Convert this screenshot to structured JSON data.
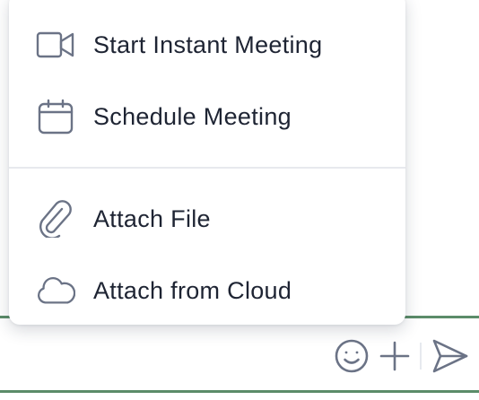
{
  "menu": {
    "items": [
      {
        "label": "Start Instant Meeting",
        "icon": "video-camera-icon"
      },
      {
        "label": "Schedule Meeting",
        "icon": "calendar-icon"
      },
      {
        "label": "Attach File",
        "icon": "paperclip-icon"
      },
      {
        "label": "Attach from Cloud",
        "icon": "cloud-icon"
      }
    ]
  },
  "composer": {
    "actions": [
      {
        "icon": "emoji-icon"
      },
      {
        "icon": "plus-icon"
      },
      {
        "icon": "send-icon"
      }
    ]
  },
  "colors": {
    "accent_border": "#5b8c69",
    "icon": "#6b7386",
    "text": "#1e2433",
    "divider": "#e7e9ee"
  }
}
